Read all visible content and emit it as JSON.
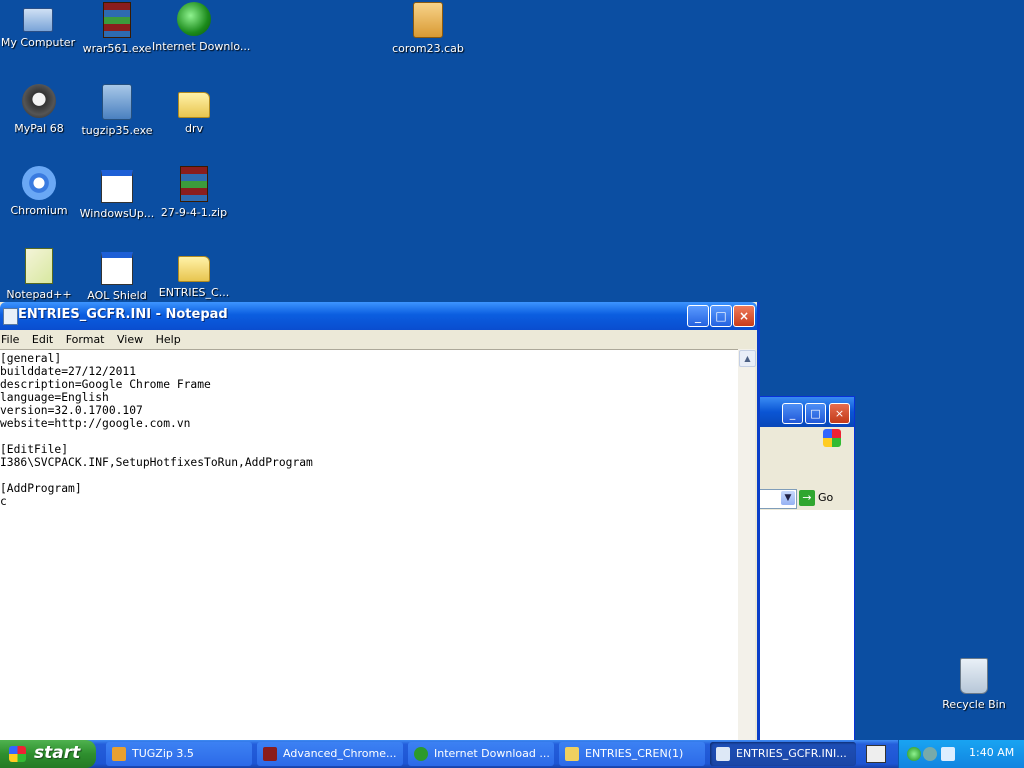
{
  "desktop": {
    "icons": [
      {
        "label": "My Computer",
        "icon": "computer-icon"
      },
      {
        "label": "wrar561.exe",
        "icon": "winrar-icon"
      },
      {
        "label": "Internet Downlo...",
        "icon": "internet-download-manager-icon"
      },
      {
        "label": "corom23.cab",
        "icon": "cab-package-icon"
      },
      {
        "label": "MyPal 68",
        "icon": "mypal-icon"
      },
      {
        "label": "tugzip35.exe",
        "icon": "tugzip-installer-icon"
      },
      {
        "label": "drv",
        "icon": "folder-icon"
      },
      {
        "label": "Chromium",
        "icon": "chromium-icon"
      },
      {
        "label": "WindowsUp...",
        "icon": "window-icon"
      },
      {
        "label": "27-9-4-1.zip",
        "icon": "winrar-archive-icon"
      },
      {
        "label": "Notepad++",
        "icon": "notepad-plus-plus-icon"
      },
      {
        "label": "AOL Shield",
        "icon": "window-icon"
      },
      {
        "label": "ENTRIES_C...",
        "icon": "folder-icon"
      },
      {
        "label": "Recycle Bin",
        "icon": "recycle-bin-icon"
      }
    ]
  },
  "explorer_window": {
    "go_label": "Go"
  },
  "notepad": {
    "title": "ENTRIES_GCFR.INI - Notepad",
    "menu": [
      "File",
      "Edit",
      "Format",
      "View",
      "Help"
    ],
    "content": "[general]\nbuilddate=27/12/2011\ndescription=Google Chrome Frame\nlanguage=English\nversion=32.0.1700.107\nwebsite=http://google.com.vn\n\n[EditFile]\nI386\\SVCPACK.INF,SetupHotfixesToRun,AddProgram\n\n[AddProgram]\nc"
  },
  "taskbar": {
    "start_label": "start",
    "buttons": [
      {
        "label": "TUGZip 3.5",
        "active": false,
        "color": "#e8a030"
      },
      {
        "label": "Advanced_Chrome...",
        "active": false,
        "color": "#8a1d1d"
      },
      {
        "label": "Internet Download ...",
        "active": false,
        "color": "#2c9a2c"
      },
      {
        "label": "ENTRIES_CREN(1)",
        "active": false,
        "color": "#f0d060"
      },
      {
        "label": "ENTRIES_GCFR.INI...",
        "active": true,
        "color": "#dde8f6"
      }
    ],
    "clock": "1:40 AM"
  }
}
